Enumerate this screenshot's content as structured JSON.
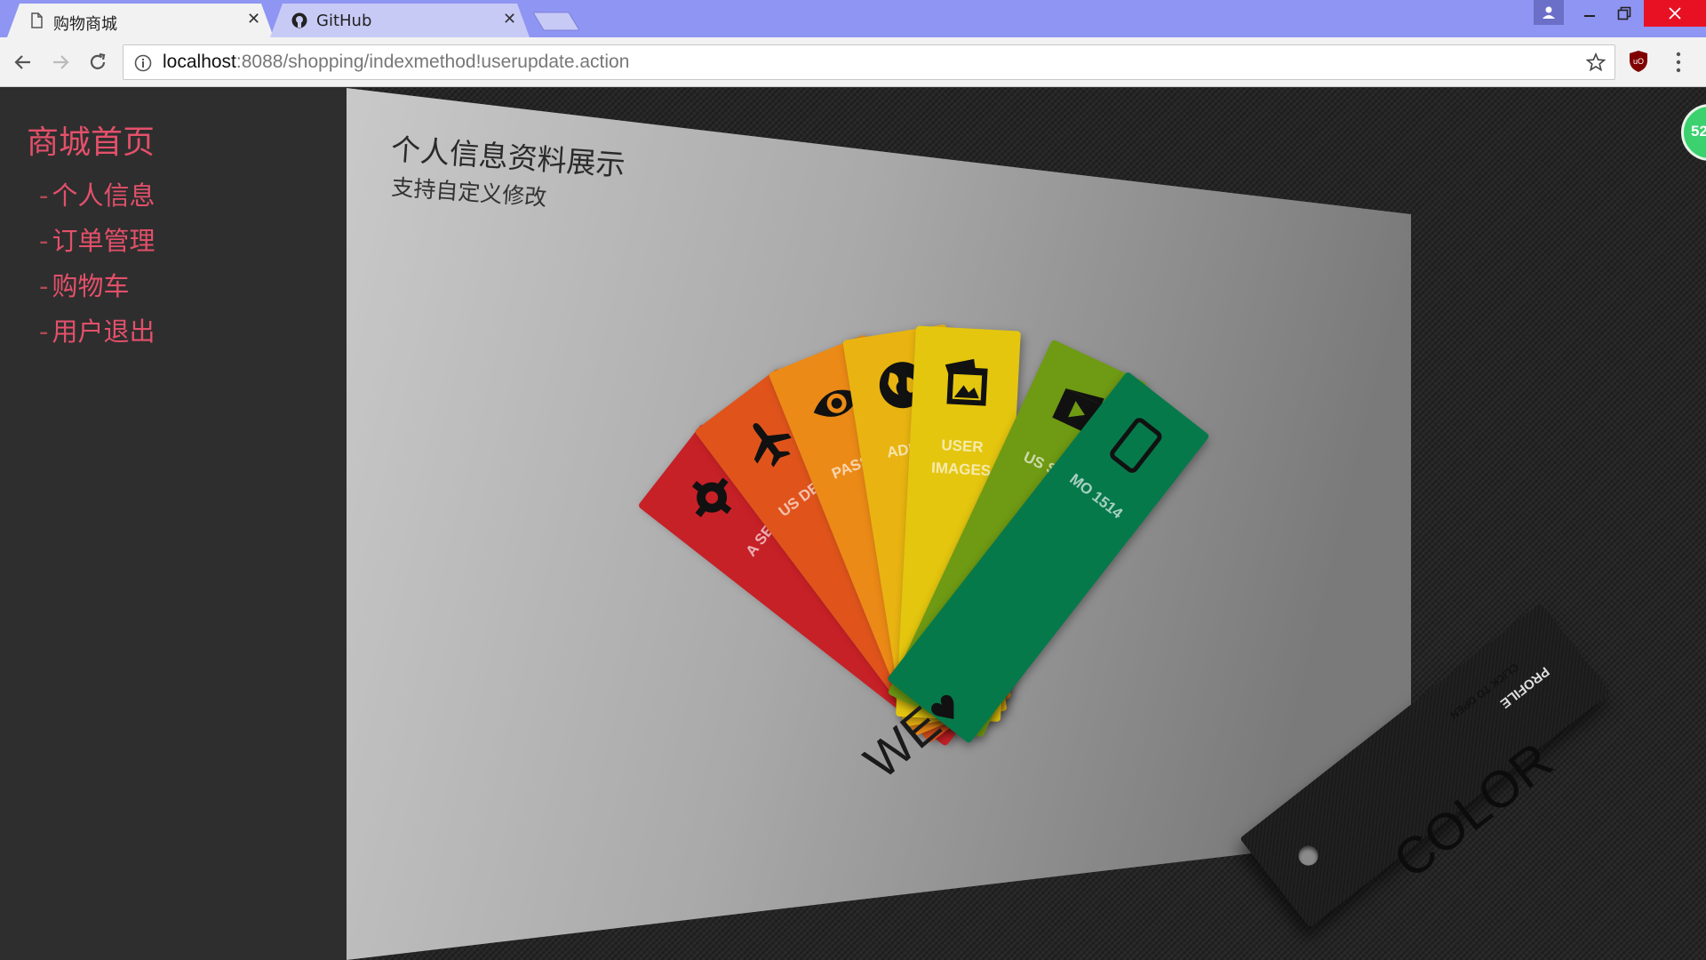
{
  "browser": {
    "tabs": [
      {
        "title": "购物商城",
        "icon": "page-icon",
        "active": true
      },
      {
        "title": "GitHub",
        "icon": "github-icon",
        "active": false
      }
    ],
    "close_symbol": "✕",
    "url_host": "localhost",
    "url_path": ":8088/shopping/indexmethod!userupdate.action",
    "colors": {
      "tabbar": "#8f95f2",
      "close": "#e81123"
    }
  },
  "sidebar": {
    "title": "商城首页",
    "dash": "-",
    "items": [
      {
        "label": "个人信息"
      },
      {
        "label": "订单管理"
      },
      {
        "label": "购物车"
      },
      {
        "label": "用户退出"
      }
    ],
    "accent_color": "#e3506a"
  },
  "main": {
    "heading": "个人信息资料展示",
    "subheading": "支持自定义修改",
    "swatches": [
      {
        "color": "#c62127",
        "icon": "gear-icon",
        "label": "A SET"
      },
      {
        "color": "#e0541c",
        "icon": "airplane-icon",
        "label": "US DEST"
      },
      {
        "color": "#ec8a17",
        "icon": "eye-icon",
        "label": "PASS 96"
      },
      {
        "color": "#e9b411",
        "icon": "globe-icon",
        "label": "ADD 辽"
      },
      {
        "color": "#e4c60f",
        "icon": "image-icon",
        "label": "USER IMAGES"
      },
      {
        "color": "#6f9a13",
        "icon": "film-icon",
        "label": "US SAN"
      },
      {
        "color": "#06794b",
        "icon": "phone-icon",
        "label": "MO 1514"
      }
    ],
    "black_card": {
      "profile": "PROFILE",
      "click": "CLICK TO OPEN",
      "slogan_left": "WE",
      "heart": "♥",
      "slogan_right": "COLOR"
    }
  },
  "badge": {
    "text": "52"
  }
}
